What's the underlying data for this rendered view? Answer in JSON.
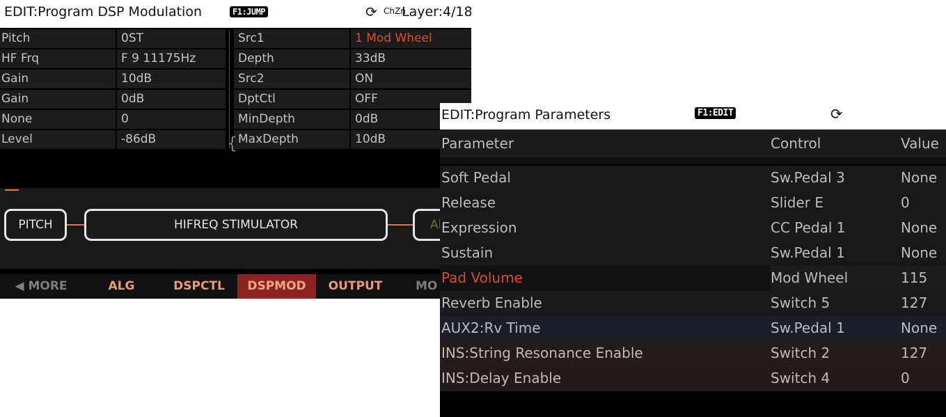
{
  "screen1": {
    "title": "EDIT:Program DSP Modulation",
    "badge": "F1:JUMP",
    "sync_icon": "⟳",
    "chzn": "ChZn",
    "layer": "Layer:4/18",
    "rows": [
      {
        "name": "Pitch",
        "value": "0ST",
        "src": "Src1",
        "src_value": "1 Mod Wheel"
      },
      {
        "name": "HF Frq",
        "value": "F 9 11175Hz",
        "src": "Depth",
        "src_value": "33dB"
      },
      {
        "name": "Gain",
        "value": "10dB",
        "src": "Src2",
        "src_value": "ON"
      },
      {
        "name": "Gain",
        "value": "0dB",
        "src": "DptCtl",
        "src_value": "OFF"
      },
      {
        "name": "None",
        "value": "0",
        "src": "MinDepth",
        "src_value": "0dB"
      },
      {
        "name": "Level",
        "value": "-86dB",
        "src": "MaxDepth",
        "src_value": "10dB"
      }
    ],
    "blocks": {
      "pitch": "PITCH",
      "hifreq": "HIFREQ STIMULATOR",
      "alg": "Al"
    },
    "softkeys": [
      "◀ MORE",
      "ALG",
      "DSPCTL",
      "DSPMOD",
      "OUTPUT",
      "MO"
    ]
  },
  "screen2": {
    "title": "EDIT:Program Parameters",
    "badge": "F1:EDIT",
    "sync_icon": "⟳",
    "headers": {
      "parameter": "Parameter",
      "control": "Control",
      "value": "Value"
    },
    "rows": [
      {
        "parameter": "Soft Pedal",
        "control": "Sw.Pedal 3",
        "value": "None"
      },
      {
        "parameter": "Release",
        "control": "Slider E",
        "value": "0"
      },
      {
        "parameter": "Expression",
        "control": "CC Pedal 1",
        "value": "None"
      },
      {
        "parameter": "Sustain",
        "control": "Sw.Pedal 1",
        "value": "None"
      },
      {
        "parameter": "Pad Volume",
        "control": "Mod Wheel",
        "value": "115"
      },
      {
        "parameter": "Reverb Enable",
        "control": "Switch 5",
        "value": "127"
      },
      {
        "parameter": "AUX2:Rv Time",
        "control": "Sw.Pedal 1",
        "value": "None"
      },
      {
        "parameter": "INS:String Resonance Enable",
        "control": "Switch 2",
        "value": "127"
      },
      {
        "parameter": "INS:Delay Enable",
        "control": "Switch 4",
        "value": "0"
      }
    ]
  },
  "colors": {
    "accent_red": "#e04b28",
    "softkey_active_bg": "#8a2321",
    "connector": "#e8734a"
  }
}
